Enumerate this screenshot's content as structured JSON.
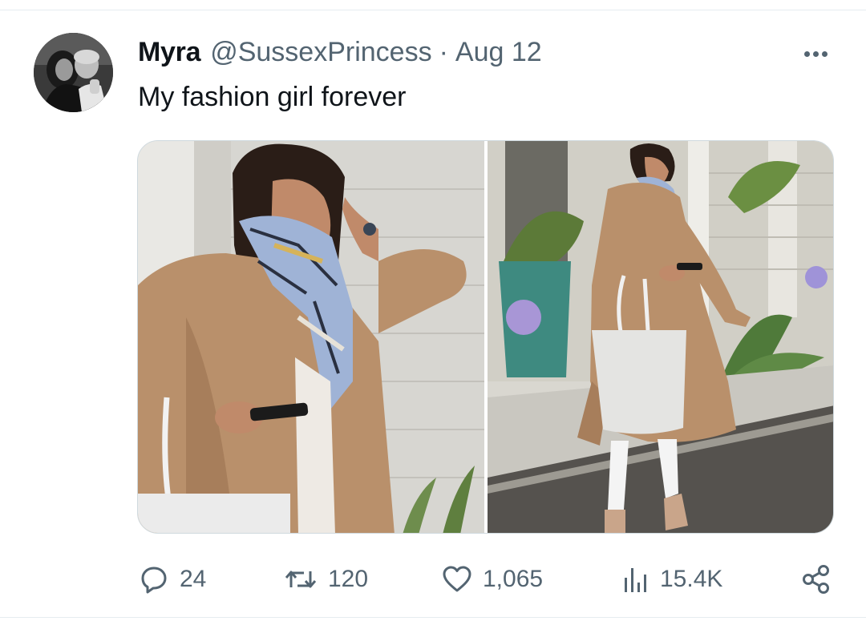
{
  "tweet": {
    "author_name": "Myra",
    "handle": "@SussexPrincess",
    "separator": "·",
    "date": "Aug 12",
    "text": "My fashion girl forever"
  },
  "media": {
    "photos": [
      {
        "icon": "photo-woman-camel-coat-closeup"
      },
      {
        "icon": "photo-woman-walking-with-tote"
      }
    ]
  },
  "actions": {
    "replies": "24",
    "retweets": "120",
    "likes": "1,065",
    "views": "15.4K"
  },
  "colors": {
    "text_primary": "#0f1419",
    "text_secondary": "#536471",
    "border": "#cfd9de"
  }
}
